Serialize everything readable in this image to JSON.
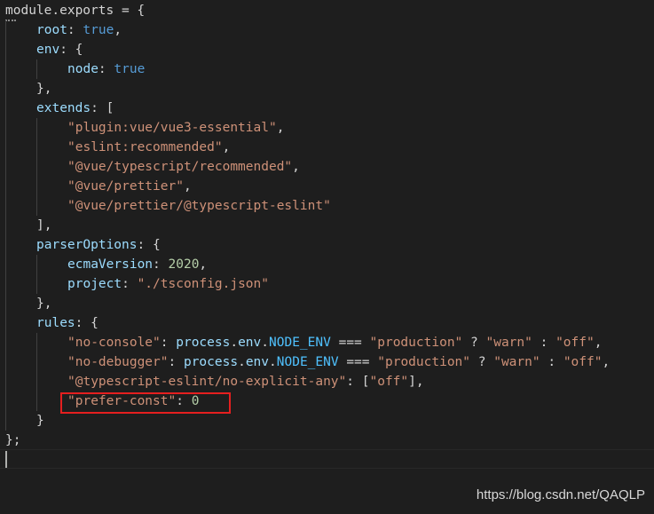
{
  "editor": {
    "theme_colors": {
      "background": "#1e1e1e",
      "key": "#9cdcfe",
      "keyword_constant": "#569cd6",
      "string": "#ce9178",
      "number": "#b5cea8",
      "function": "#dcdcaa",
      "env_constant": "#4fc1ff",
      "highlight_box": "#e51f1f"
    },
    "lines": [
      {
        "indent": 0,
        "tokens": [
          [
            "module.exports",
            "punc"
          ],
          [
            " = {",
            "punc"
          ]
        ]
      },
      {
        "indent": 1,
        "tokens": [
          [
            "root",
            "key"
          ],
          [
            ": ",
            "punc"
          ],
          [
            "true",
            "const"
          ],
          [
            ",",
            "punc"
          ]
        ]
      },
      {
        "indent": 1,
        "tokens": [
          [
            "env",
            "key"
          ],
          [
            ": {",
            "punc"
          ]
        ]
      },
      {
        "indent": 2,
        "tokens": [
          [
            "node",
            "key"
          ],
          [
            ": ",
            "punc"
          ],
          [
            "true",
            "const"
          ]
        ]
      },
      {
        "indent": 1,
        "tokens": [
          [
            "},",
            "punc"
          ]
        ]
      },
      {
        "indent": 1,
        "tokens": [
          [
            "extends",
            "key"
          ],
          [
            ": [",
            "punc"
          ]
        ]
      },
      {
        "indent": 2,
        "tokens": [
          [
            "\"plugin:vue/vue3-essential\"",
            "str"
          ],
          [
            ",",
            "punc"
          ]
        ]
      },
      {
        "indent": 2,
        "tokens": [
          [
            "\"eslint:recommended\"",
            "str"
          ],
          [
            ",",
            "punc"
          ]
        ]
      },
      {
        "indent": 2,
        "tokens": [
          [
            "\"@vue/typescript/recommended\"",
            "str"
          ],
          [
            ",",
            "punc"
          ]
        ]
      },
      {
        "indent": 2,
        "tokens": [
          [
            "\"@vue/prettier\"",
            "str"
          ],
          [
            ",",
            "punc"
          ]
        ]
      },
      {
        "indent": 2,
        "tokens": [
          [
            "\"@vue/prettier/@typescript-eslint\"",
            "str"
          ]
        ]
      },
      {
        "indent": 1,
        "tokens": [
          [
            "],",
            "punc"
          ]
        ]
      },
      {
        "indent": 1,
        "tokens": [
          [
            "parserOptions",
            "key"
          ],
          [
            ": {",
            "punc"
          ]
        ]
      },
      {
        "indent": 2,
        "tokens": [
          [
            "ecmaVersion",
            "key"
          ],
          [
            ": ",
            "punc"
          ],
          [
            "2020",
            "num"
          ],
          [
            ",",
            "punc"
          ]
        ]
      },
      {
        "indent": 2,
        "tokens": [
          [
            "project",
            "key"
          ],
          [
            ": ",
            "punc"
          ],
          [
            "\"./tsconfig.json\"",
            "str"
          ]
        ]
      },
      {
        "indent": 1,
        "tokens": [
          [
            "},",
            "punc"
          ]
        ]
      },
      {
        "indent": 1,
        "tokens": [
          [
            "rules",
            "key"
          ],
          [
            ": {",
            "punc"
          ]
        ]
      },
      {
        "indent": 2,
        "tokens": [
          [
            "\"no-console\"",
            "str"
          ],
          [
            ": ",
            "punc"
          ],
          [
            "process",
            "key"
          ],
          [
            ".",
            "punc"
          ],
          [
            "env",
            "key"
          ],
          [
            ".",
            "punc"
          ],
          [
            "NODE_ENV",
            "env"
          ],
          [
            " === ",
            "punc"
          ],
          [
            "\"production\"",
            "str"
          ],
          [
            " ? ",
            "punc"
          ],
          [
            "\"warn\"",
            "str"
          ],
          [
            " : ",
            "punc"
          ],
          [
            "\"off\"",
            "str"
          ],
          [
            ",",
            "punc"
          ]
        ]
      },
      {
        "indent": 2,
        "tokens": [
          [
            "\"no-debugger\"",
            "str"
          ],
          [
            ": ",
            "punc"
          ],
          [
            "process",
            "key"
          ],
          [
            ".",
            "punc"
          ],
          [
            "env",
            "key"
          ],
          [
            ".",
            "punc"
          ],
          [
            "NODE_ENV",
            "env"
          ],
          [
            " === ",
            "punc"
          ],
          [
            "\"production\"",
            "str"
          ],
          [
            " ? ",
            "punc"
          ],
          [
            "\"warn\"",
            "str"
          ],
          [
            " : ",
            "punc"
          ],
          [
            "\"off\"",
            "str"
          ],
          [
            ",",
            "punc"
          ]
        ]
      },
      {
        "indent": 2,
        "tokens": [
          [
            "\"@typescript-eslint/no-explicit-any\"",
            "str"
          ],
          [
            ": [",
            "punc"
          ],
          [
            "\"off\"",
            "str"
          ],
          [
            "],",
            "punc"
          ]
        ]
      },
      {
        "indent": 2,
        "tokens": [
          [
            "\"prefer-const\"",
            "str"
          ],
          [
            ": ",
            "punc"
          ],
          [
            "0",
            "num"
          ]
        ]
      },
      {
        "indent": 1,
        "tokens": [
          [
            "}",
            "punc"
          ]
        ]
      },
      {
        "indent": 0,
        "tokens": [
          [
            "};",
            "punc"
          ]
        ]
      },
      {
        "indent": 0,
        "tokens": []
      }
    ]
  },
  "watermark": "https://blog.csdn.net/QAQLP"
}
